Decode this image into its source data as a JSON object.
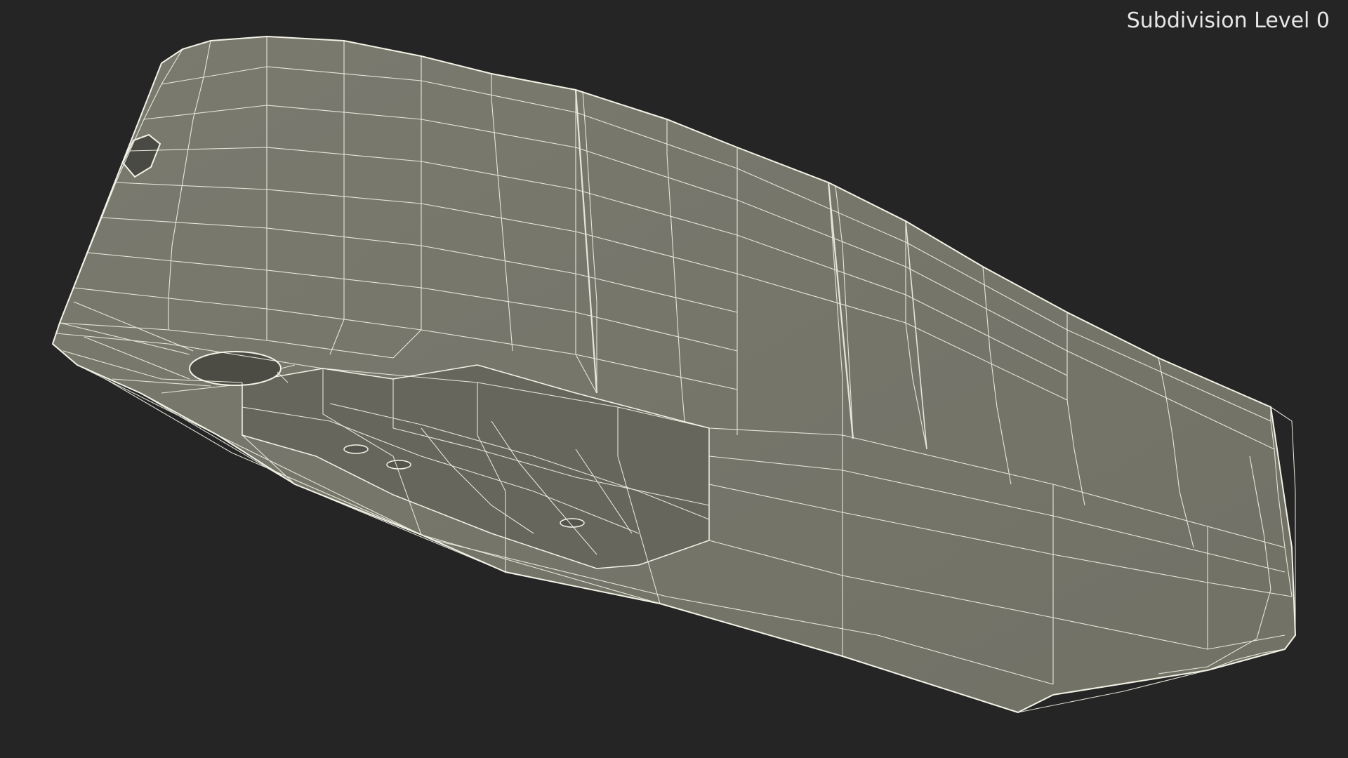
{
  "viewport": {
    "subdivision_label": "Subdivision Level 0",
    "background_color": "#252525",
    "model": {
      "shading": "wireframe-on-shaded",
      "surface_color": "#75756a",
      "wire_color": "#f2f2e6"
    }
  }
}
